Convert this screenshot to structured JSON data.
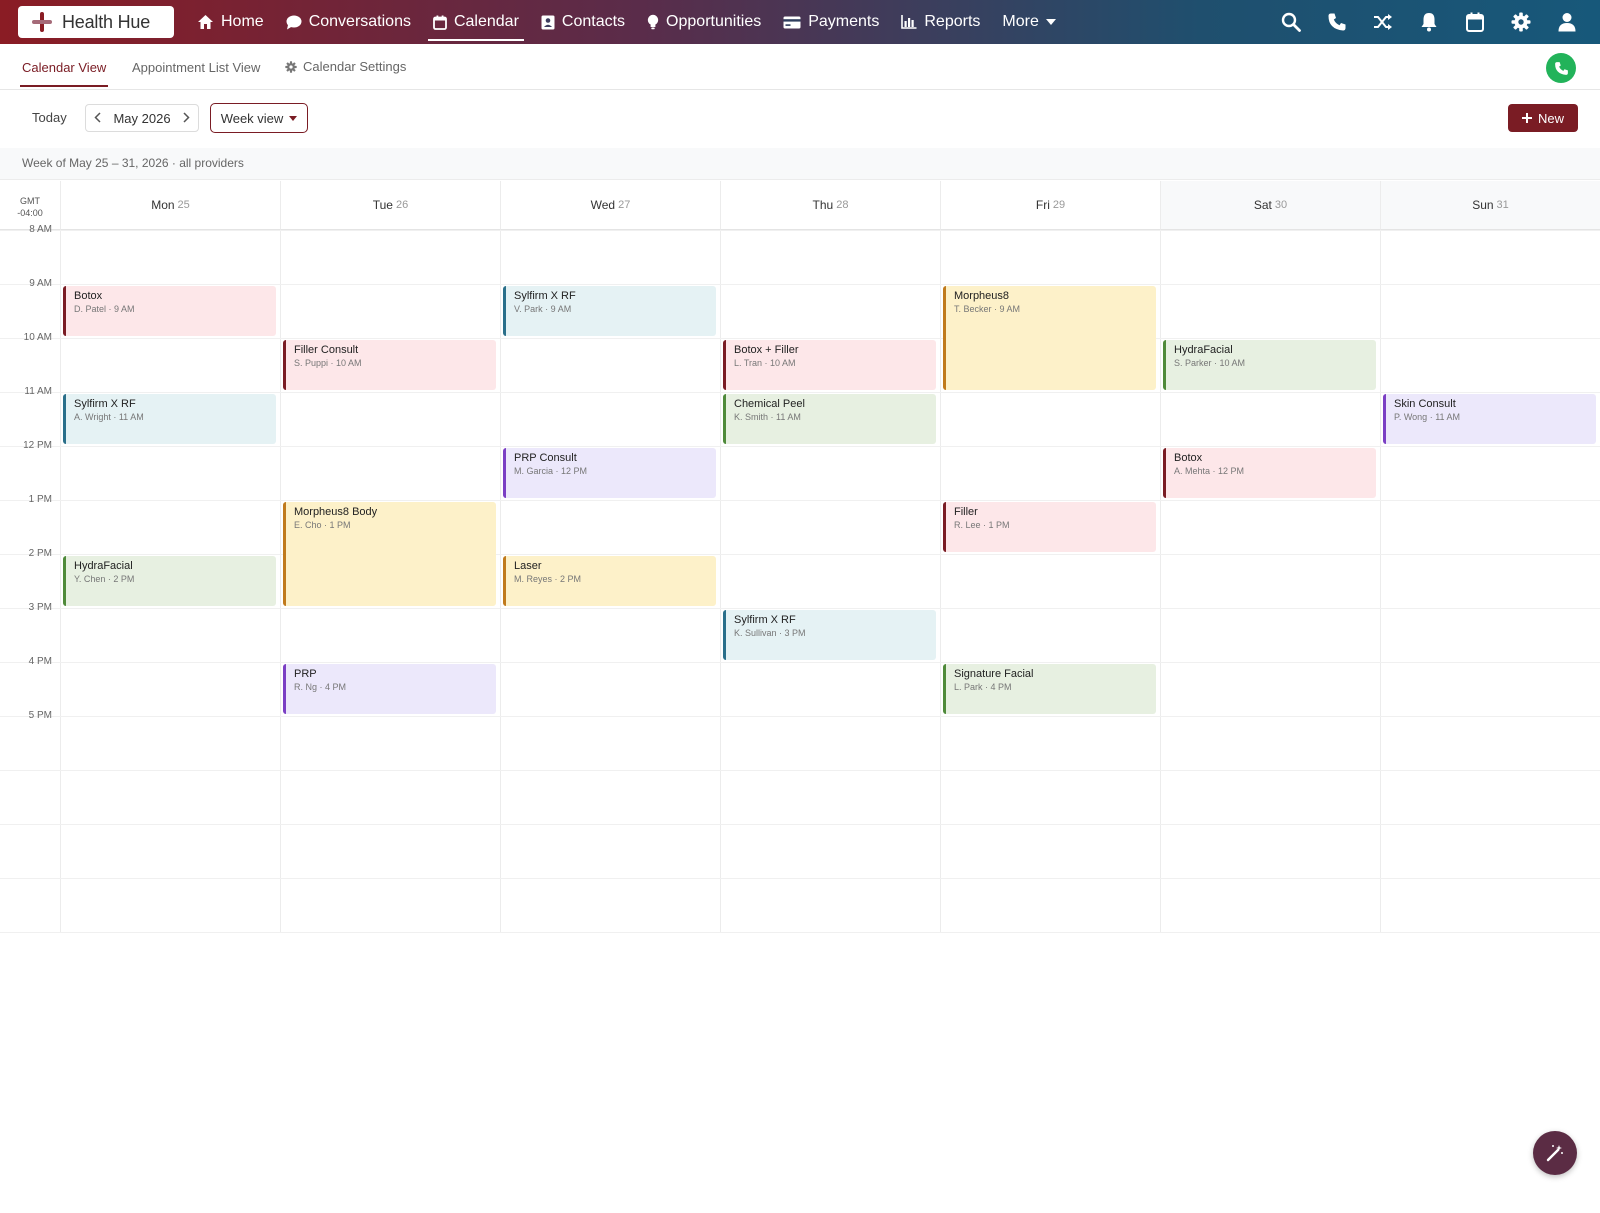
{
  "brand": {
    "name": "Health Hue"
  },
  "nav": {
    "items": [
      {
        "label": "Home",
        "icon": "home-icon"
      },
      {
        "label": "Conversations",
        "icon": "chat-icon"
      },
      {
        "label": "Calendar",
        "icon": "calendar-icon",
        "active": true
      },
      {
        "label": "Contacts",
        "icon": "contact-card-icon"
      },
      {
        "label": "Opportunities",
        "icon": "lightbulb-icon"
      },
      {
        "label": "Payments",
        "icon": "credit-card-icon"
      },
      {
        "label": "Reports",
        "icon": "bar-chart-icon"
      },
      {
        "label": "More",
        "icon": "caret-down-icon"
      }
    ],
    "right_icons": [
      "search-icon",
      "phone-icon",
      "shuffle-icon",
      "bell-icon",
      "calendar-icon",
      "gear-icon",
      "user-icon"
    ]
  },
  "subtabs": {
    "calendar_view": "Calendar View",
    "appointment_list": "Appointment List View",
    "settings": "Calendar Settings"
  },
  "toolbar": {
    "today": "Today",
    "month": "May 2026",
    "view": "Week view",
    "new": "New"
  },
  "week_label": "Week of May 25 – 31, 2026 · all providers",
  "timezone": {
    "line1": "GMT",
    "line2": "-04:00"
  },
  "days": [
    {
      "name": "Mon",
      "num": "25"
    },
    {
      "name": "Tue",
      "num": "26"
    },
    {
      "name": "Wed",
      "num": "27"
    },
    {
      "name": "Thu",
      "num": "28"
    },
    {
      "name": "Fri",
      "num": "29"
    },
    {
      "name": "Sat",
      "num": "30"
    },
    {
      "name": "Sun",
      "num": "31"
    }
  ],
  "time_labels": {
    "t0": "8 AM",
    "t1": "9 AM",
    "t2": "10 AM",
    "t3": "11 AM",
    "t4": "12 PM",
    "t5": "1 PM",
    "t6": "2 PM",
    "t7": "3 PM",
    "t8": "4 PM",
    "t9": "5 PM"
  },
  "events": [
    {
      "title": "Botox",
      "sub": "D. Patel · 9 AM",
      "day": 0,
      "start": 1,
      "span": 1,
      "color": "red"
    },
    {
      "title": "Sylfirm X RF",
      "sub": "A. Wright · 11 AM",
      "day": 0,
      "start": 3,
      "span": 1,
      "color": "blue"
    },
    {
      "title": "HydraFacial",
      "sub": "Y. Chen · 2 PM",
      "day": 0,
      "start": 6,
      "span": 1,
      "color": "green"
    },
    {
      "title": "Filler Consult",
      "sub": "S. Puppi · 10 AM",
      "day": 1,
      "start": 2,
      "span": 1,
      "color": "red"
    },
    {
      "title": "Morpheus8 Body",
      "sub": "E. Cho · 1 PM",
      "day": 1,
      "start": 5,
      "span": 2,
      "color": "yellow"
    },
    {
      "title": "PRP",
      "sub": "R. Ng · 4 PM",
      "day": 1,
      "start": 8,
      "span": 1,
      "color": "purple"
    },
    {
      "title": "Sylfirm X RF",
      "sub": "V. Park · 9 AM",
      "day": 2,
      "start": 1,
      "span": 1,
      "color": "blue"
    },
    {
      "title": "PRP Consult",
      "sub": "M. Garcia · 12 PM",
      "day": 2,
      "start": 4,
      "span": 1,
      "color": "purple"
    },
    {
      "title": "Laser",
      "sub": "M. Reyes · 2 PM",
      "day": 2,
      "start": 6,
      "span": 1,
      "color": "yellow"
    },
    {
      "title": "Botox + Filler",
      "sub": "L. Tran · 10 AM",
      "day": 3,
      "start": 2,
      "span": 1,
      "color": "red"
    },
    {
      "title": "Chemical Peel",
      "sub": "K. Smith · 11 AM",
      "day": 3,
      "start": 3,
      "span": 1,
      "color": "green"
    },
    {
      "title": "Sylfirm X RF",
      "sub": "K. Sullivan · 3 PM",
      "day": 3,
      "start": 7,
      "span": 1,
      "color": "blue"
    },
    {
      "title": "Morpheus8",
      "sub": "T. Becker · 9 AM",
      "day": 4,
      "start": 1,
      "span": 2,
      "color": "yellow"
    },
    {
      "title": "Filler",
      "sub": "R. Lee · 1 PM",
      "day": 4,
      "start": 5,
      "span": 1,
      "color": "red"
    },
    {
      "title": "Signature Facial",
      "sub": "L. Park · 4 PM",
      "day": 4,
      "start": 8,
      "span": 1,
      "color": "green"
    },
    {
      "title": "HydraFacial",
      "sub": "S. Parker · 10 AM",
      "day": 5,
      "start": 2,
      "span": 1,
      "color": "green"
    },
    {
      "title": "Botox",
      "sub": "A. Mehta · 12 PM",
      "day": 5,
      "start": 4,
      "span": 1,
      "color": "red"
    },
    {
      "title": "Skin Consult",
      "sub": "P. Wong · 11 AM",
      "day": 6,
      "start": 3,
      "span": 1,
      "color": "purple"
    }
  ]
}
